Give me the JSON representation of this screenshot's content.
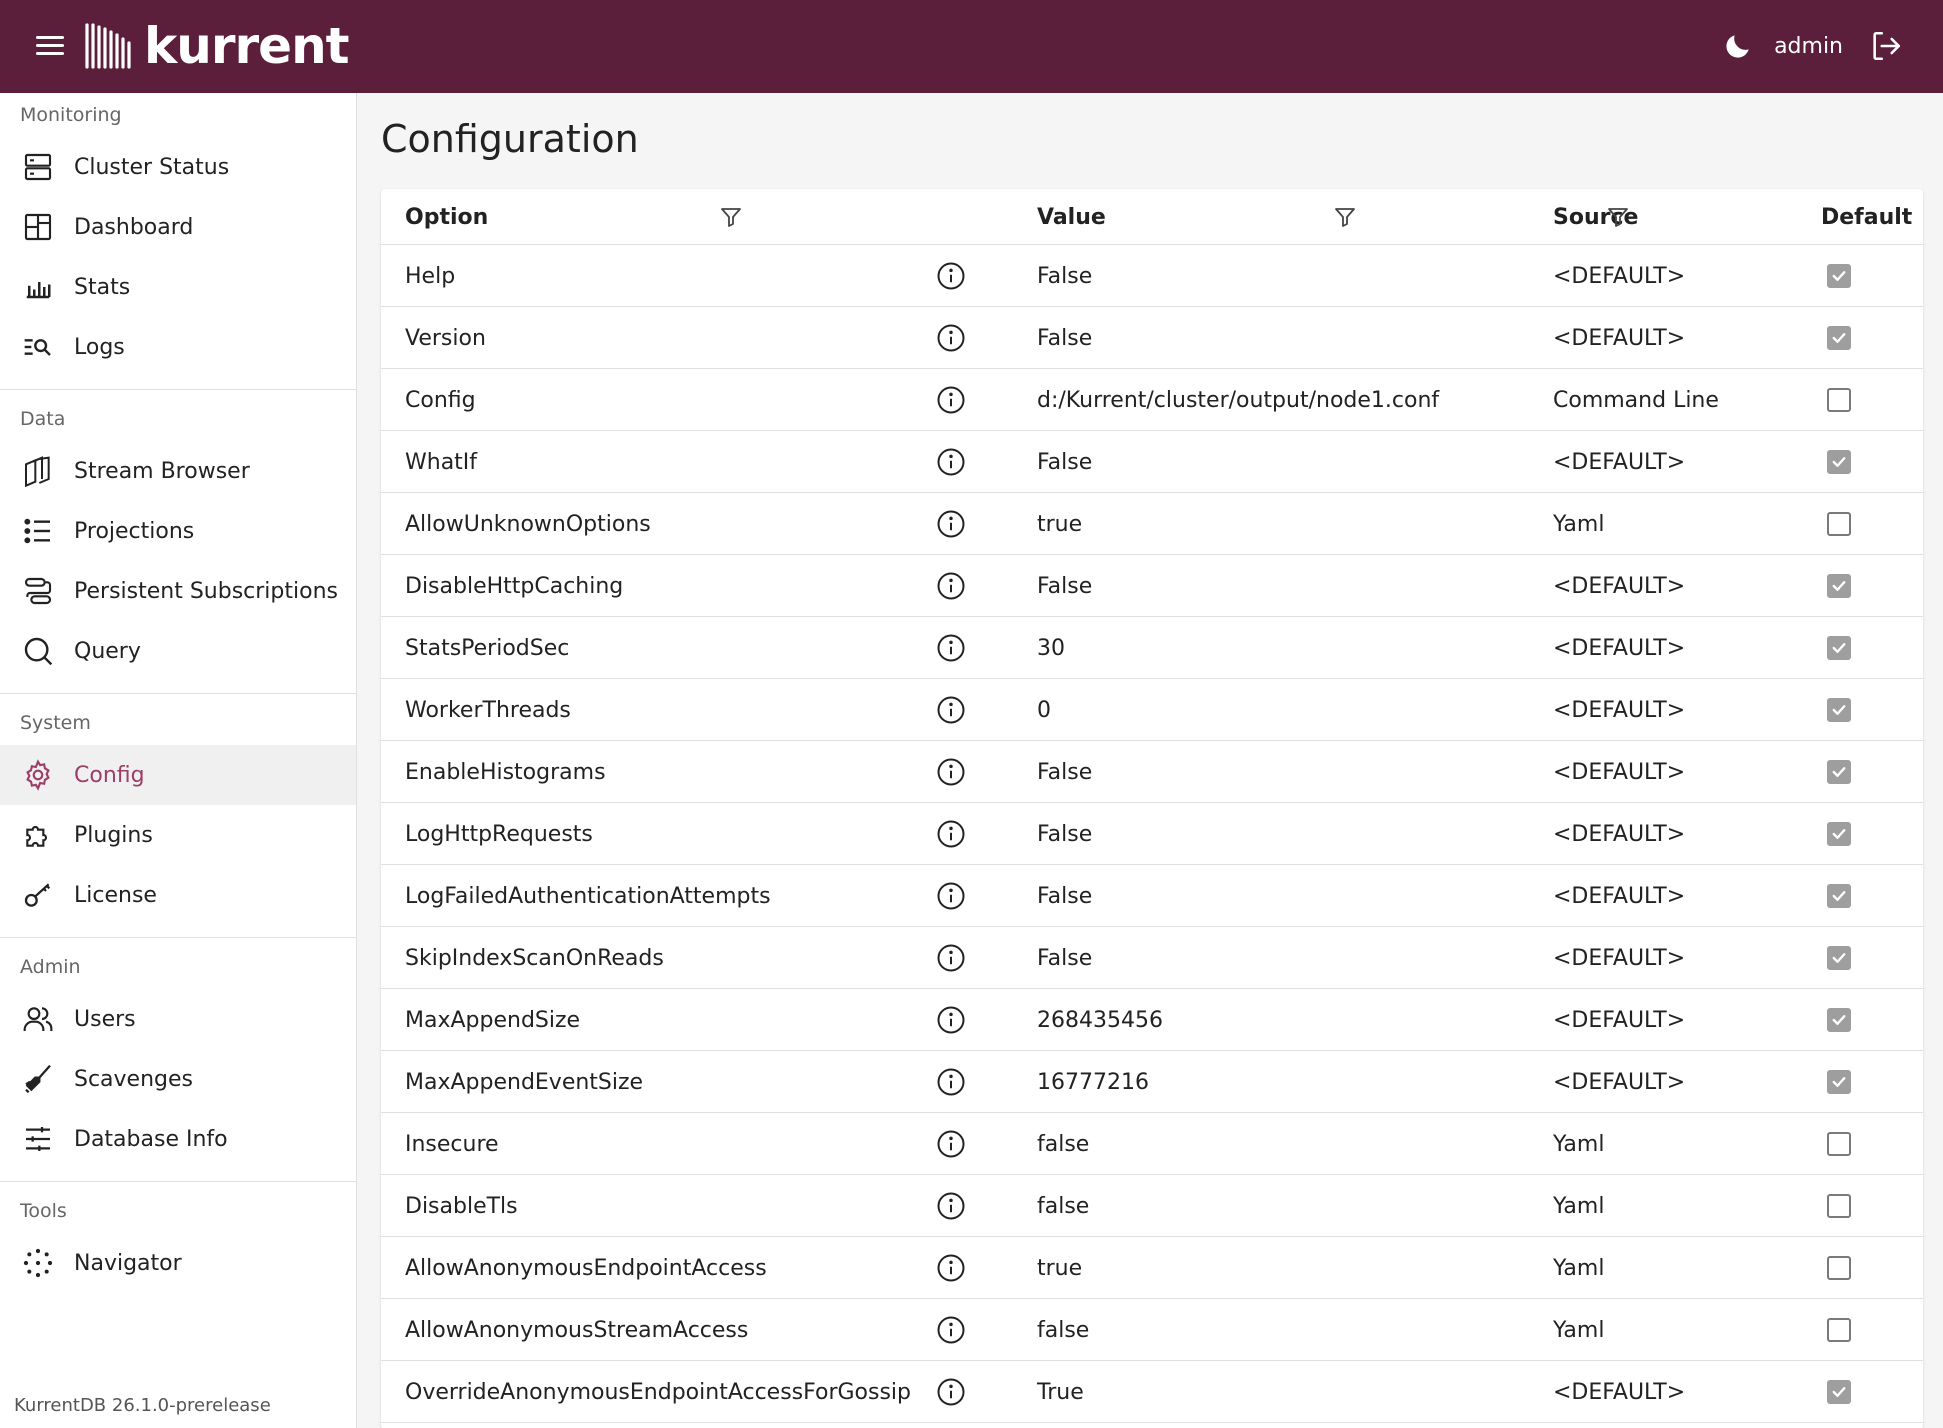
{
  "header": {
    "logo_text": "kurrent",
    "user": "admin"
  },
  "sidebar": {
    "sections": [
      {
        "title": "Monitoring",
        "items": [
          {
            "label": "Cluster Status",
            "icon": "server-icon"
          },
          {
            "label": "Dashboard",
            "icon": "dashboard-icon"
          },
          {
            "label": "Stats",
            "icon": "bar-chart-icon"
          },
          {
            "label": "Logs",
            "icon": "log-search-icon"
          }
        ]
      },
      {
        "title": "Data",
        "items": [
          {
            "label": "Stream Browser",
            "icon": "stream-icon"
          },
          {
            "label": "Projections",
            "icon": "list-icon"
          },
          {
            "label": "Persistent Subscriptions",
            "icon": "subscription-icon"
          },
          {
            "label": "Query",
            "icon": "search-icon"
          }
        ]
      },
      {
        "title": "System",
        "items": [
          {
            "label": "Config",
            "icon": "gear-icon",
            "active": true
          },
          {
            "label": "Plugins",
            "icon": "puzzle-icon"
          },
          {
            "label": "License",
            "icon": "key-icon"
          }
        ]
      },
      {
        "title": "Admin",
        "items": [
          {
            "label": "Users",
            "icon": "users-icon"
          },
          {
            "label": "Scavenges",
            "icon": "broom-icon"
          },
          {
            "label": "Database Info",
            "icon": "sliders-icon"
          }
        ]
      },
      {
        "title": "Tools",
        "items": [
          {
            "label": "Navigator",
            "icon": "navigator-icon"
          }
        ]
      }
    ],
    "version": "KurrentDB 26.1.0-prerelease"
  },
  "main": {
    "title": "Configuration",
    "columns": {
      "option": "Option",
      "value": "Value",
      "source": "Source",
      "default": "Default"
    },
    "rows": [
      {
        "option": "Help",
        "value": "False",
        "source": "<DEFAULT>",
        "default": true
      },
      {
        "option": "Version",
        "value": "False",
        "source": "<DEFAULT>",
        "default": true
      },
      {
        "option": "Config",
        "value": "d:/Kurrent/cluster/output/node1.conf",
        "source": "Command Line",
        "default": false
      },
      {
        "option": "WhatIf",
        "value": "False",
        "source": "<DEFAULT>",
        "default": true
      },
      {
        "option": "AllowUnknownOptions",
        "value": "true",
        "source": "Yaml",
        "default": false
      },
      {
        "option": "DisableHttpCaching",
        "value": "False",
        "source": "<DEFAULT>",
        "default": true
      },
      {
        "option": "StatsPeriodSec",
        "value": "30",
        "source": "<DEFAULT>",
        "default": true
      },
      {
        "option": "WorkerThreads",
        "value": "0",
        "source": "<DEFAULT>",
        "default": true
      },
      {
        "option": "EnableHistograms",
        "value": "False",
        "source": "<DEFAULT>",
        "default": true
      },
      {
        "option": "LogHttpRequests",
        "value": "False",
        "source": "<DEFAULT>",
        "default": true
      },
      {
        "option": "LogFailedAuthenticationAttempts",
        "value": "False",
        "source": "<DEFAULT>",
        "default": true
      },
      {
        "option": "SkipIndexScanOnReads",
        "value": "False",
        "source": "<DEFAULT>",
        "default": true
      },
      {
        "option": "MaxAppendSize",
        "value": "268435456",
        "source": "<DEFAULT>",
        "default": true
      },
      {
        "option": "MaxAppendEventSize",
        "value": "16777216",
        "source": "<DEFAULT>",
        "default": true
      },
      {
        "option": "Insecure",
        "value": "false",
        "source": "Yaml",
        "default": false
      },
      {
        "option": "DisableTls",
        "value": "false",
        "source": "Yaml",
        "default": false
      },
      {
        "option": "AllowAnonymousEndpointAccess",
        "value": "true",
        "source": "Yaml",
        "default": false
      },
      {
        "option": "AllowAnonymousStreamAccess",
        "value": "false",
        "source": "Yaml",
        "default": false
      },
      {
        "option": "OverrideAnonymousEndpointAccessForGossip",
        "value": "True",
        "source": "<DEFAULT>",
        "default": true
      }
    ]
  },
  "colors": {
    "header_bg": "#5c1f3b",
    "accent": "#9c3e68"
  }
}
